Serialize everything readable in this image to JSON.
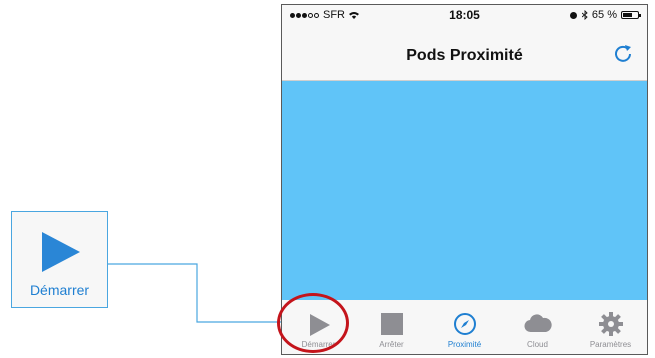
{
  "status": {
    "carrier": "SFR",
    "time": "18:05",
    "battery_text": "65 %",
    "battery_level": 0.65
  },
  "nav": {
    "title": "Pods Proximité",
    "refresh_icon": "refresh-icon"
  },
  "tabs": [
    {
      "label": "Démarrer",
      "icon": "play-icon"
    },
    {
      "label": "Arrêter",
      "icon": "stop-icon"
    },
    {
      "label": "Proximité",
      "icon": "compass-icon",
      "active": true
    },
    {
      "label": "Cloud",
      "icon": "cloud-icon"
    },
    {
      "label": "Paramètres",
      "icon": "gear-icon"
    }
  ],
  "callout": {
    "label": "Démarrer",
    "icon": "play-icon"
  },
  "colors": {
    "content_bg": "#60c4f8",
    "accent": "#1f7fd1",
    "callout_border": "#4aa6e0",
    "highlight_circle": "#c4141b",
    "tab_inactive": "#8e8e93"
  }
}
